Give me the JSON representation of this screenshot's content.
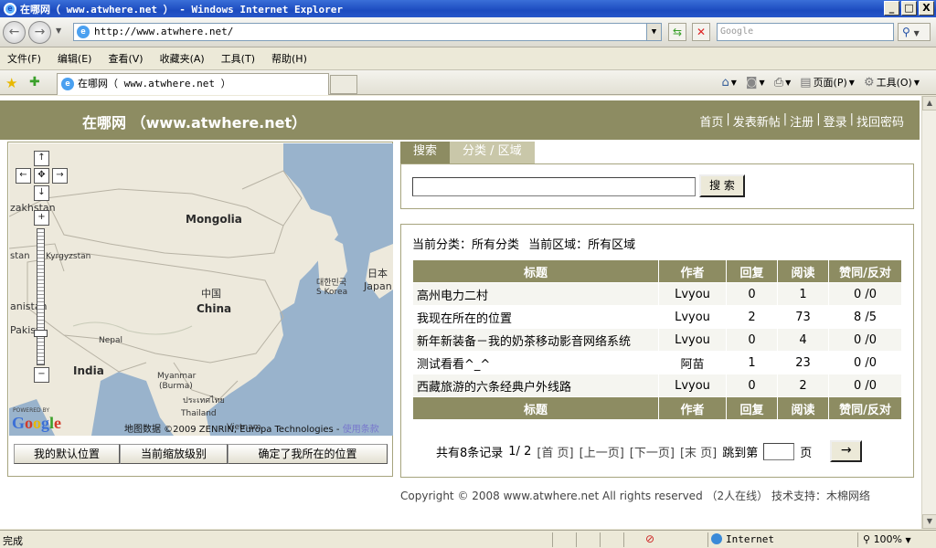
{
  "window": {
    "title": "在哪网（ www.atwhere.net ） - Windows Internet Explorer",
    "buttons": [
      "_",
      "□",
      "X"
    ]
  },
  "address_bar": {
    "url": "http://www.atwhere.net/",
    "search_placeholder": "Google"
  },
  "menu": [
    "文件(F)",
    "编辑(E)",
    "查看(V)",
    "收藏夹(A)",
    "工具(T)",
    "帮助(H)"
  ],
  "tab": {
    "title": "在哪网（ www.atwhere.net ）"
  },
  "command_bar": {
    "page_label": "页面(P)",
    "tools_label": "工具(O)"
  },
  "site": {
    "title": "在哪网 （www.atwhere.net）",
    "nav": [
      "首页",
      "发表新帖",
      "注册",
      "登录",
      "找回密码"
    ]
  },
  "map": {
    "labels": {
      "kazakhstan": "zakhstan",
      "mongolia": "Mongolia",
      "kyrgyzstan": "Kyrgyzstan",
      "stan": "stan",
      "zhongguo": "中国",
      "china": "China",
      "korea_ko": "대한민국",
      "korea": "S Korea",
      "japan_jp": "日本",
      "japan": "Japan",
      "anistan": "anistan",
      "pakistan": "Pakist",
      "nepal": "Nepal",
      "india": "India",
      "myanmar": "Myanmar",
      "burma": "(Burma)",
      "thailand_th": "ประเทศไทย",
      "thailand": "Thailand",
      "vietnam": "Vietnam"
    },
    "powered": "POWERED BY",
    "logo": "Google",
    "attribution": "地图数据 ©2009 ZENRIN, Europa Technologies - ",
    "terms_link": "使用条款",
    "buttons": [
      "我的默认位置",
      "当前缩放级别",
      "确定了我所在的位置"
    ]
  },
  "tabs": [
    "搜索",
    "分类 / 区域"
  ],
  "search": {
    "button": "搜 索"
  },
  "filter": {
    "category": "当前分类：所有分类",
    "region": "当前区域：所有区域"
  },
  "table": {
    "headers": [
      "标题",
      "作者",
      "回复",
      "阅读",
      "赞同/反对"
    ],
    "rows": [
      [
        "高州电力二村",
        "Lvyou",
        "0",
        "1",
        "0 /0"
      ],
      [
        "我现在所在的位置",
        "Lvyou",
        "2",
        "73",
        "8 /5"
      ],
      [
        "新年新装备－我的奶茶移动影音网络系统",
        "Lvyou",
        "0",
        "4",
        "0 /0"
      ],
      [
        "测试看看^_^",
        "阿苗",
        "1",
        "23",
        "0 /0"
      ],
      [
        "西藏旅游的六条经典户外线路",
        "Lvyou",
        "0",
        "2",
        "0 /0"
      ]
    ]
  },
  "pager": {
    "total": "共有8条记录",
    "page": "1/ 2",
    "first": "[首 页]",
    "prev": "[上一页]",
    "next": "[下一页]",
    "last": "[末 页]",
    "jump": "跳到第",
    "unit": "页",
    "go": "→"
  },
  "footer": "Copyright © 2008 www.atwhere.net All rights reserved （2人在线） 技术支持：木棉网络",
  "status": {
    "text": "完成",
    "zone": "Internet",
    "zoom": "100%"
  }
}
